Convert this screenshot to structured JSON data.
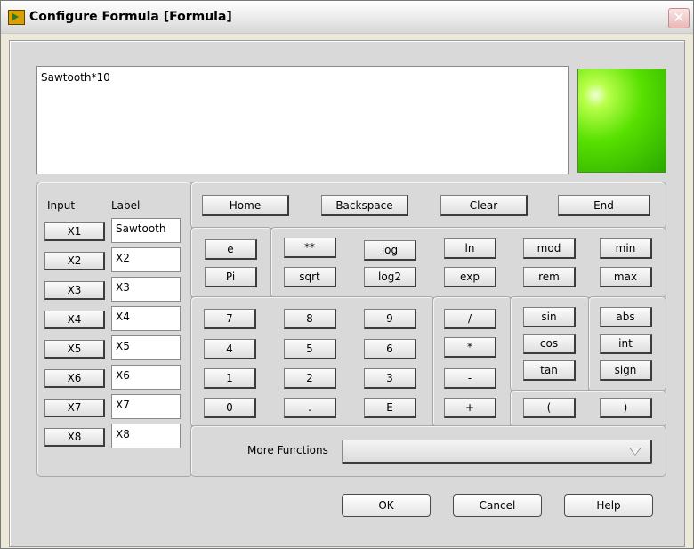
{
  "window": {
    "title": "Configure Formula [Formula]",
    "close_glyph": "✕"
  },
  "formula": {
    "text": "Sawtooth*10",
    "led_color": "#2aa800"
  },
  "inputs": {
    "header_input": "Input",
    "header_label": "Label",
    "rows": [
      {
        "button": "X1",
        "label": "Sawtooth"
      },
      {
        "button": "X2",
        "label": "X2"
      },
      {
        "button": "X3",
        "label": "X3"
      },
      {
        "button": "X4",
        "label": "X4"
      },
      {
        "button": "X5",
        "label": "X5"
      },
      {
        "button": "X6",
        "label": "X6"
      },
      {
        "button": "X7",
        "label": "X7"
      },
      {
        "button": "X8",
        "label": "X8"
      }
    ]
  },
  "nav": {
    "home": "Home",
    "backspace": "Backspace",
    "clear": "Clear",
    "end": "End"
  },
  "constants": {
    "e": "e",
    "pi": "Pi"
  },
  "ops": {
    "pow": "**",
    "log": "log",
    "ln": "ln",
    "mod": "mod",
    "min": "min",
    "sqrt": "sqrt",
    "log2": "log2",
    "exp": "exp",
    "rem": "rem",
    "max": "max"
  },
  "keypad": {
    "k7": "7",
    "k8": "8",
    "k9": "9",
    "k4": "4",
    "k5": "5",
    "k6": "6",
    "k1": "1",
    "k2": "2",
    "k3": "3",
    "k0": "0",
    "dot": ".",
    "E": "E"
  },
  "arith": {
    "div": "/",
    "mul": "*",
    "sub": "-",
    "add": "+"
  },
  "trig": {
    "sin": "sin",
    "cos": "cos",
    "tan": "tan"
  },
  "misc": {
    "abs": "abs",
    "int": "int",
    "sign": "sign"
  },
  "parens": {
    "open": "(",
    "close": ")"
  },
  "more": {
    "label": "More Functions",
    "selected": ""
  },
  "dialog": {
    "ok": "OK",
    "cancel": "Cancel",
    "help": "Help"
  }
}
